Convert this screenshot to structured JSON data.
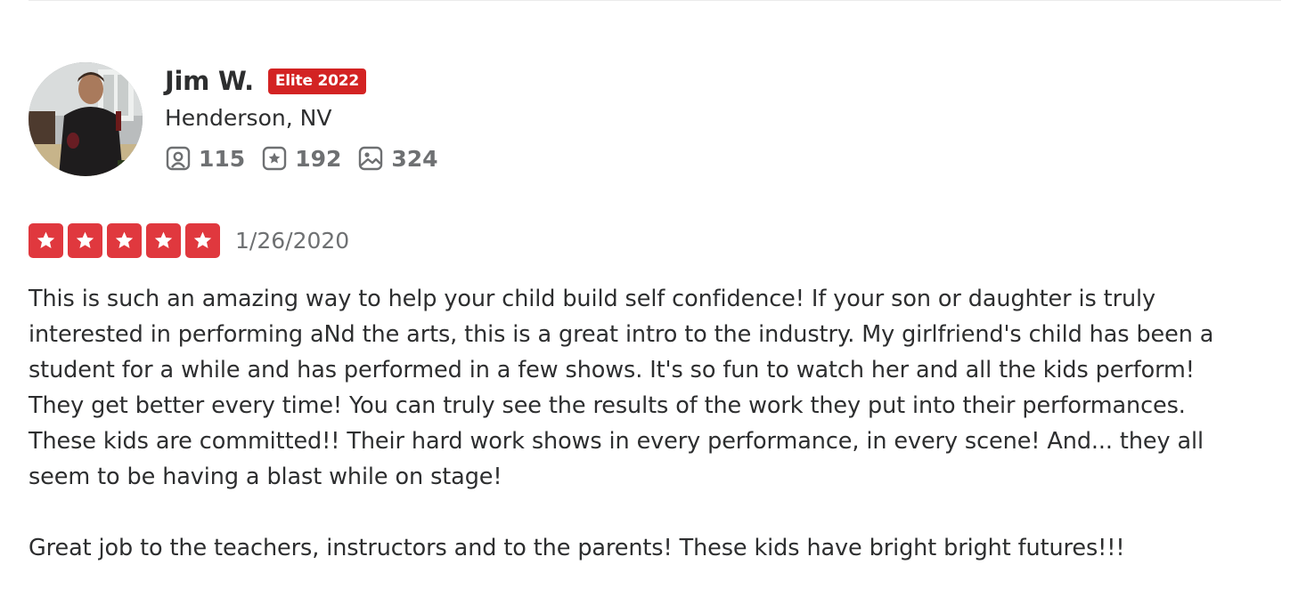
{
  "review": {
    "user": {
      "name": "Jim W.",
      "elite_badge": "Elite 2022",
      "location": "Henderson, NV",
      "avatar_icon": "user-avatar-photo",
      "stats": {
        "friends": "115",
        "friends_icon": "friends-icon",
        "reviews": "192",
        "reviews_icon": "review-star-icon",
        "photos": "324",
        "photos_icon": "photo-icon"
      }
    },
    "rating": 5,
    "rating_max": 5,
    "date": "1/26/2020",
    "text": "This is such an amazing way to help your child build self confidence! If your son or daughter is truly interested in performing aNd the arts, this is a great intro to the industry. My girlfriend's child has been a student for a while and has performed in a few shows. It's so fun to watch her and all  the kids perform! They get better every time! You can truly see the results of the work they put into their performances. These kids are committed!! Their hard work shows in every performance, in every scene! And... they all seem to be having a blast while on stage!\n\nGreat job to the teachers, instructors and to the parents! These kids have bright bright futures!!!"
  },
  "colors": {
    "brand_red": "#d32323",
    "star_red": "#e0383e",
    "text_dark": "#2d2e2f",
    "text_muted": "#6e7072"
  }
}
